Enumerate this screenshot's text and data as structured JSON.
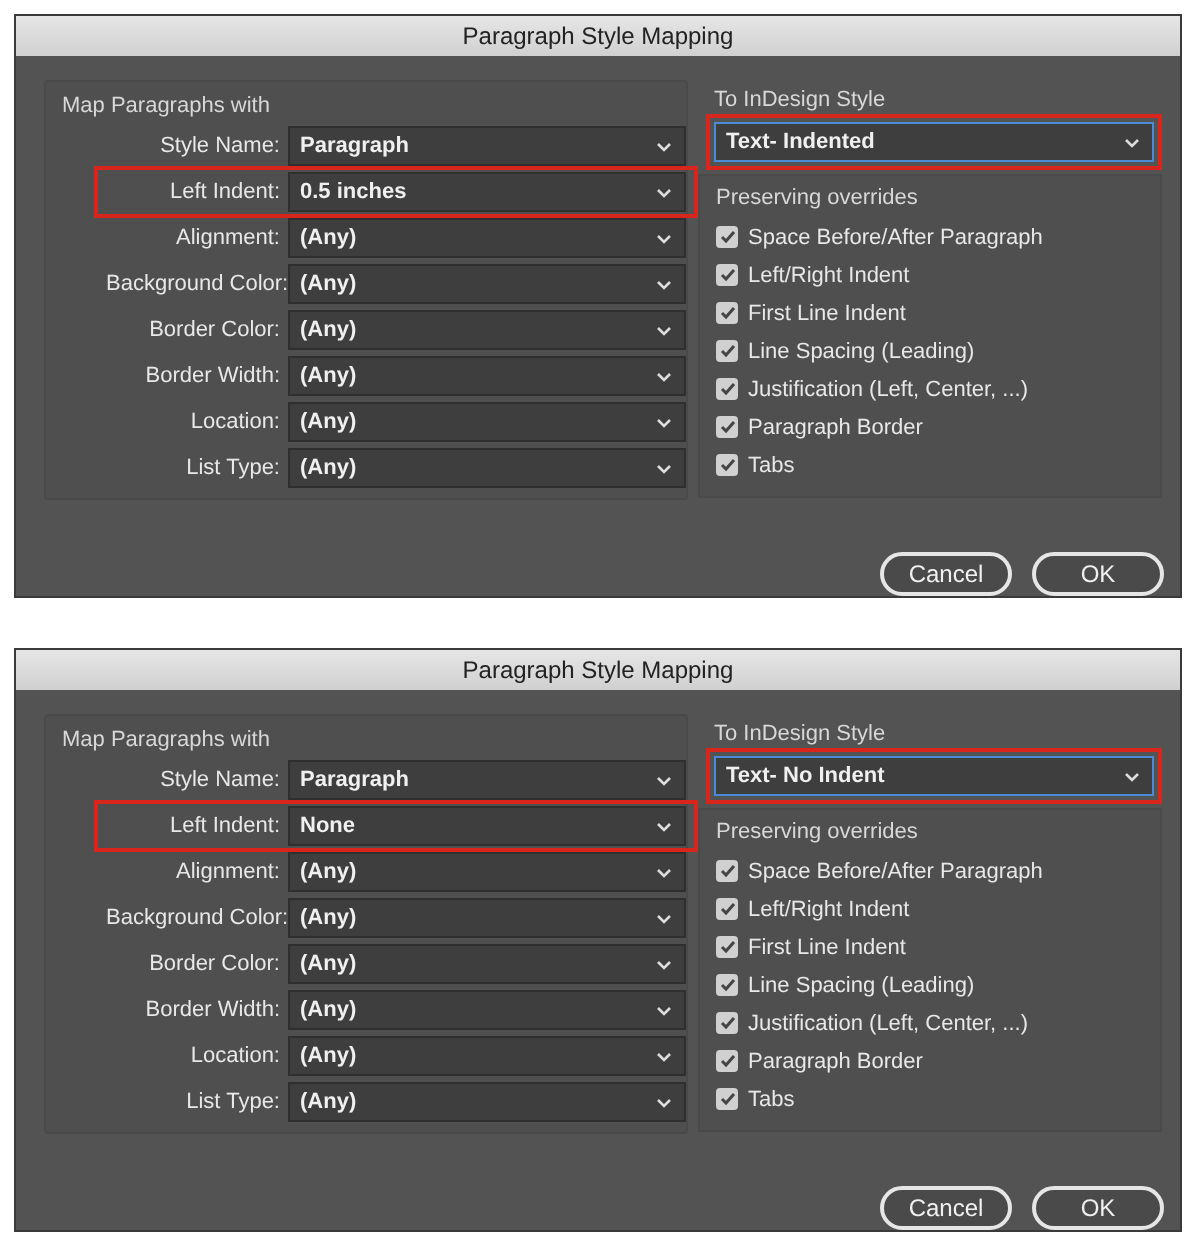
{
  "dialogs": [
    {
      "title": "Paragraph Style Mapping",
      "map_group": {
        "heading": "Map Paragraphs with",
        "fields": [
          {
            "label": "Style Name:",
            "value": "Paragraph",
            "highlighted": false
          },
          {
            "label": "Left Indent:",
            "value": "0.5 inches",
            "highlighted": true
          },
          {
            "label": "Alignment:",
            "value": "(Any)",
            "highlighted": false
          },
          {
            "label": "Background Color:",
            "value": "(Any)",
            "highlighted": false
          },
          {
            "label": "Border Color:",
            "value": "(Any)",
            "highlighted": false
          },
          {
            "label": "Border Width:",
            "value": "(Any)",
            "highlighted": false
          },
          {
            "label": "Location:",
            "value": "(Any)",
            "highlighted": false
          },
          {
            "label": "List Type:",
            "value": "(Any)",
            "highlighted": false
          }
        ]
      },
      "target": {
        "heading": "To InDesign Style",
        "value": "Text- Indented",
        "highlighted": true
      },
      "overrides": {
        "heading": "Preserving overrides",
        "items": [
          {
            "label": "Space Before/After Paragraph",
            "checked": true
          },
          {
            "label": "Left/Right Indent",
            "checked": true
          },
          {
            "label": "First Line Indent",
            "checked": true
          },
          {
            "label": "Line Spacing (Leading)",
            "checked": true
          },
          {
            "label": "Justification (Left, Center, ...)",
            "checked": true
          },
          {
            "label": "Paragraph Border",
            "checked": true
          },
          {
            "label": "Tabs",
            "checked": true
          }
        ]
      },
      "buttons": [
        "Cancel",
        "OK"
      ]
    },
    {
      "title": "Paragraph Style Mapping",
      "map_group": {
        "heading": "Map Paragraphs with",
        "fields": [
          {
            "label": "Style Name:",
            "value": "Paragraph",
            "highlighted": false
          },
          {
            "label": "Left Indent:",
            "value": "None",
            "highlighted": true
          },
          {
            "label": "Alignment:",
            "value": "(Any)",
            "highlighted": false
          },
          {
            "label": "Background Color:",
            "value": "(Any)",
            "highlighted": false
          },
          {
            "label": "Border Color:",
            "value": "(Any)",
            "highlighted": false
          },
          {
            "label": "Border Width:",
            "value": "(Any)",
            "highlighted": false
          },
          {
            "label": "Location:",
            "value": "(Any)",
            "highlighted": false
          },
          {
            "label": "List Type:",
            "value": "(Any)",
            "highlighted": false
          }
        ]
      },
      "target": {
        "heading": "To InDesign Style",
        "value": "Text- No Indent",
        "highlighted": true
      },
      "overrides": {
        "heading": "Preserving overrides",
        "items": [
          {
            "label": "Space Before/After Paragraph",
            "checked": true
          },
          {
            "label": "Left/Right Indent",
            "checked": true
          },
          {
            "label": "First Line Indent",
            "checked": true
          },
          {
            "label": "Line Spacing (Leading)",
            "checked": true
          },
          {
            "label": "Justification (Left, Center, ...)",
            "checked": true
          },
          {
            "label": "Paragraph Border",
            "checked": true
          },
          {
            "label": "Tabs",
            "checked": true
          }
        ]
      },
      "buttons": [
        "Cancel",
        "OK"
      ]
    }
  ]
}
